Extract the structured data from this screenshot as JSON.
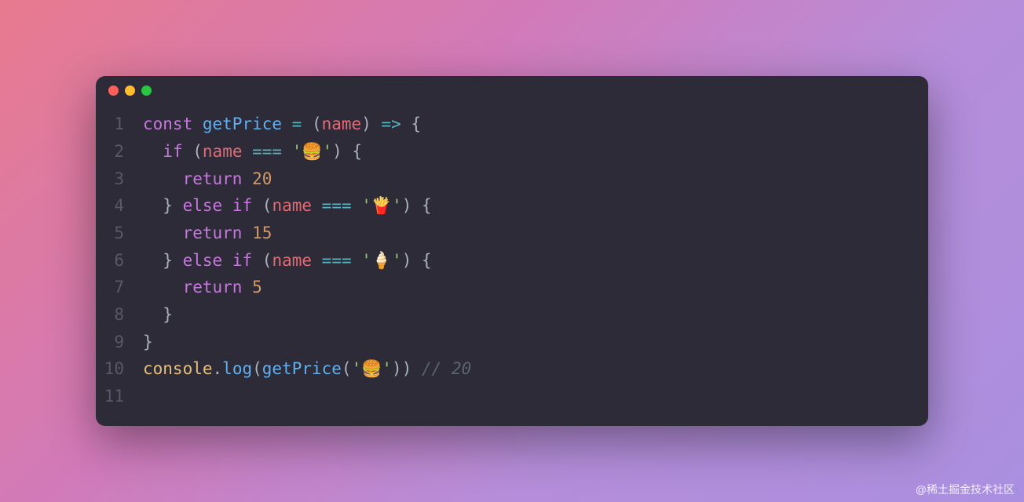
{
  "window": {
    "controls": {
      "close": "close",
      "minimize": "minimize",
      "maximize": "maximize"
    }
  },
  "code": {
    "lineNumbers": [
      "1",
      "2",
      "3",
      "4",
      "5",
      "6",
      "7",
      "8",
      "9",
      "10",
      "11"
    ],
    "lines": {
      "l1": {
        "kw_const": "const",
        "fn_name": "getPrice",
        "eq": " = ",
        "lparen": "(",
        "param": "name",
        "rparen": ")",
        "arrow": " => ",
        "lbrace": "{"
      },
      "l2": {
        "indent": "  ",
        "kw_if": "if",
        "sp": " ",
        "lparen": "(",
        "param": "name",
        "op": " === ",
        "str_open": "'",
        "emoji": "🍔",
        "str_close": "'",
        "rparen": ")",
        "sp2": " ",
        "lbrace": "{"
      },
      "l3": {
        "indent": "    ",
        "kw_return": "return",
        "sp": " ",
        "num": "20"
      },
      "l4": {
        "indent": "  ",
        "rbrace": "}",
        "sp": " ",
        "kw_else": "else",
        "sp2": " ",
        "kw_if": "if",
        "sp3": " ",
        "lparen": "(",
        "param": "name",
        "op": " === ",
        "str_open": "'",
        "emoji": "🍟",
        "str_close": "'",
        "rparen": ")",
        "sp4": " ",
        "lbrace": "{"
      },
      "l5": {
        "indent": "    ",
        "kw_return": "return",
        "sp": " ",
        "num": "15"
      },
      "l6": {
        "indent": "  ",
        "rbrace": "}",
        "sp": " ",
        "kw_else": "else",
        "sp2": " ",
        "kw_if": "if",
        "sp3": " ",
        "lparen": "(",
        "param": "name",
        "op": " === ",
        "str_open": "'",
        "emoji": "🍦",
        "str_close": "'",
        "rparen": ")",
        "sp4": " ",
        "lbrace": "{"
      },
      "l7": {
        "indent": "    ",
        "kw_return": "return",
        "sp": " ",
        "num": "5"
      },
      "l8": {
        "indent": "  ",
        "rbrace": "}"
      },
      "l9": {
        "rbrace": "}"
      },
      "l10": {
        "obj": "console",
        "dot": ".",
        "method": "log",
        "lparen": "(",
        "fn": "getPrice",
        "lparen2": "(",
        "str_open": "'",
        "emoji": "🍔",
        "str_close": "'",
        "rparen": ")",
        "rparen2": ")",
        "sp": " ",
        "comment": "// 20"
      },
      "l11": {
        "empty": ""
      }
    }
  },
  "watermark": "@稀土掘金技术社区"
}
